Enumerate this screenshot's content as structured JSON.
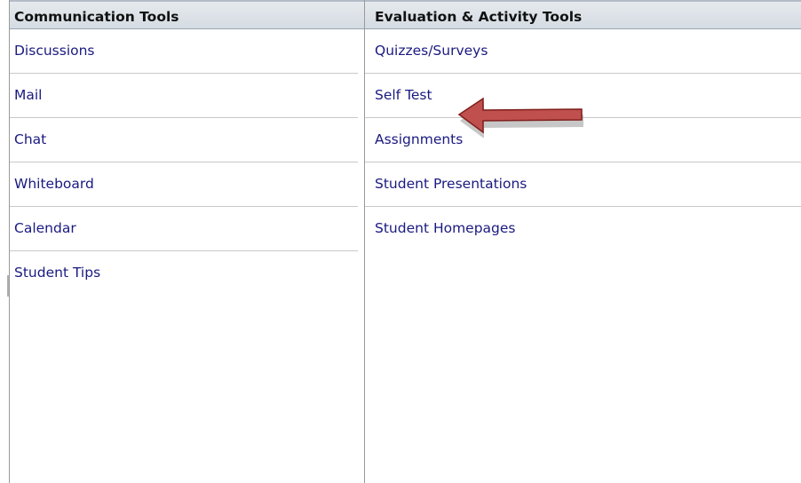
{
  "communication": {
    "header": "Communication Tools",
    "items": [
      "Discussions",
      "Mail",
      "Chat",
      "Whiteboard",
      "Calendar",
      "Student Tips"
    ]
  },
  "evaluation": {
    "header": "Evaluation & Activity Tools",
    "items": [
      "Quizzes/Surveys",
      "Self Test",
      "Assignments",
      "Student Presentations",
      "Student Homepages"
    ]
  },
  "annotation": {
    "icon": "left-arrow-icon",
    "points_to": "Self Test",
    "fill_color": "#c0504d",
    "edge_color": "#7f1e1b"
  }
}
